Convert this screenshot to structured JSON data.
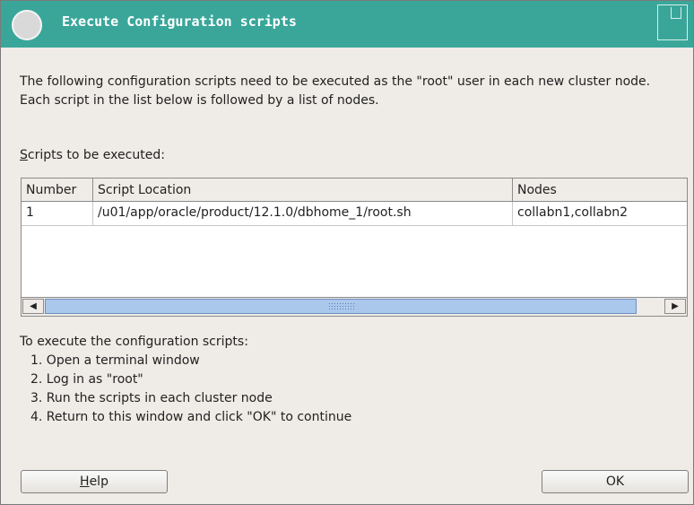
{
  "window": {
    "title": "Execute Configuration scripts"
  },
  "description": "The following configuration scripts need to be executed as the \"root\" user in each new cluster node. Each script in the list below is followed by a list of nodes.",
  "scripts_label": {
    "mnemonic": "S",
    "rest": "cripts to be executed:"
  },
  "table": {
    "columns": [
      "Number",
      "Script Location",
      "Nodes"
    ],
    "rows": [
      [
        "1",
        "/u01/app/oracle/product/12.1.0/dbhome_1/root.sh",
        "collabn1,collabn2"
      ]
    ]
  },
  "instructions": {
    "heading": "To execute the configuration scripts:",
    "steps": [
      "1. Open a terminal window",
      "2. Log in as \"root\"",
      "3. Run the scripts in each cluster node",
      "4. Return to this window and click \"OK\" to continue"
    ]
  },
  "buttons": {
    "help": {
      "mnemonic": "H",
      "rest": "elp"
    },
    "ok": "OK"
  },
  "icons": {
    "scroll_left": "scroll-left-arrow-icon",
    "scroll_right": "scroll-right-arrow-icon",
    "maximize": "maximize-icon",
    "window_menu": "window-menu-icon"
  }
}
